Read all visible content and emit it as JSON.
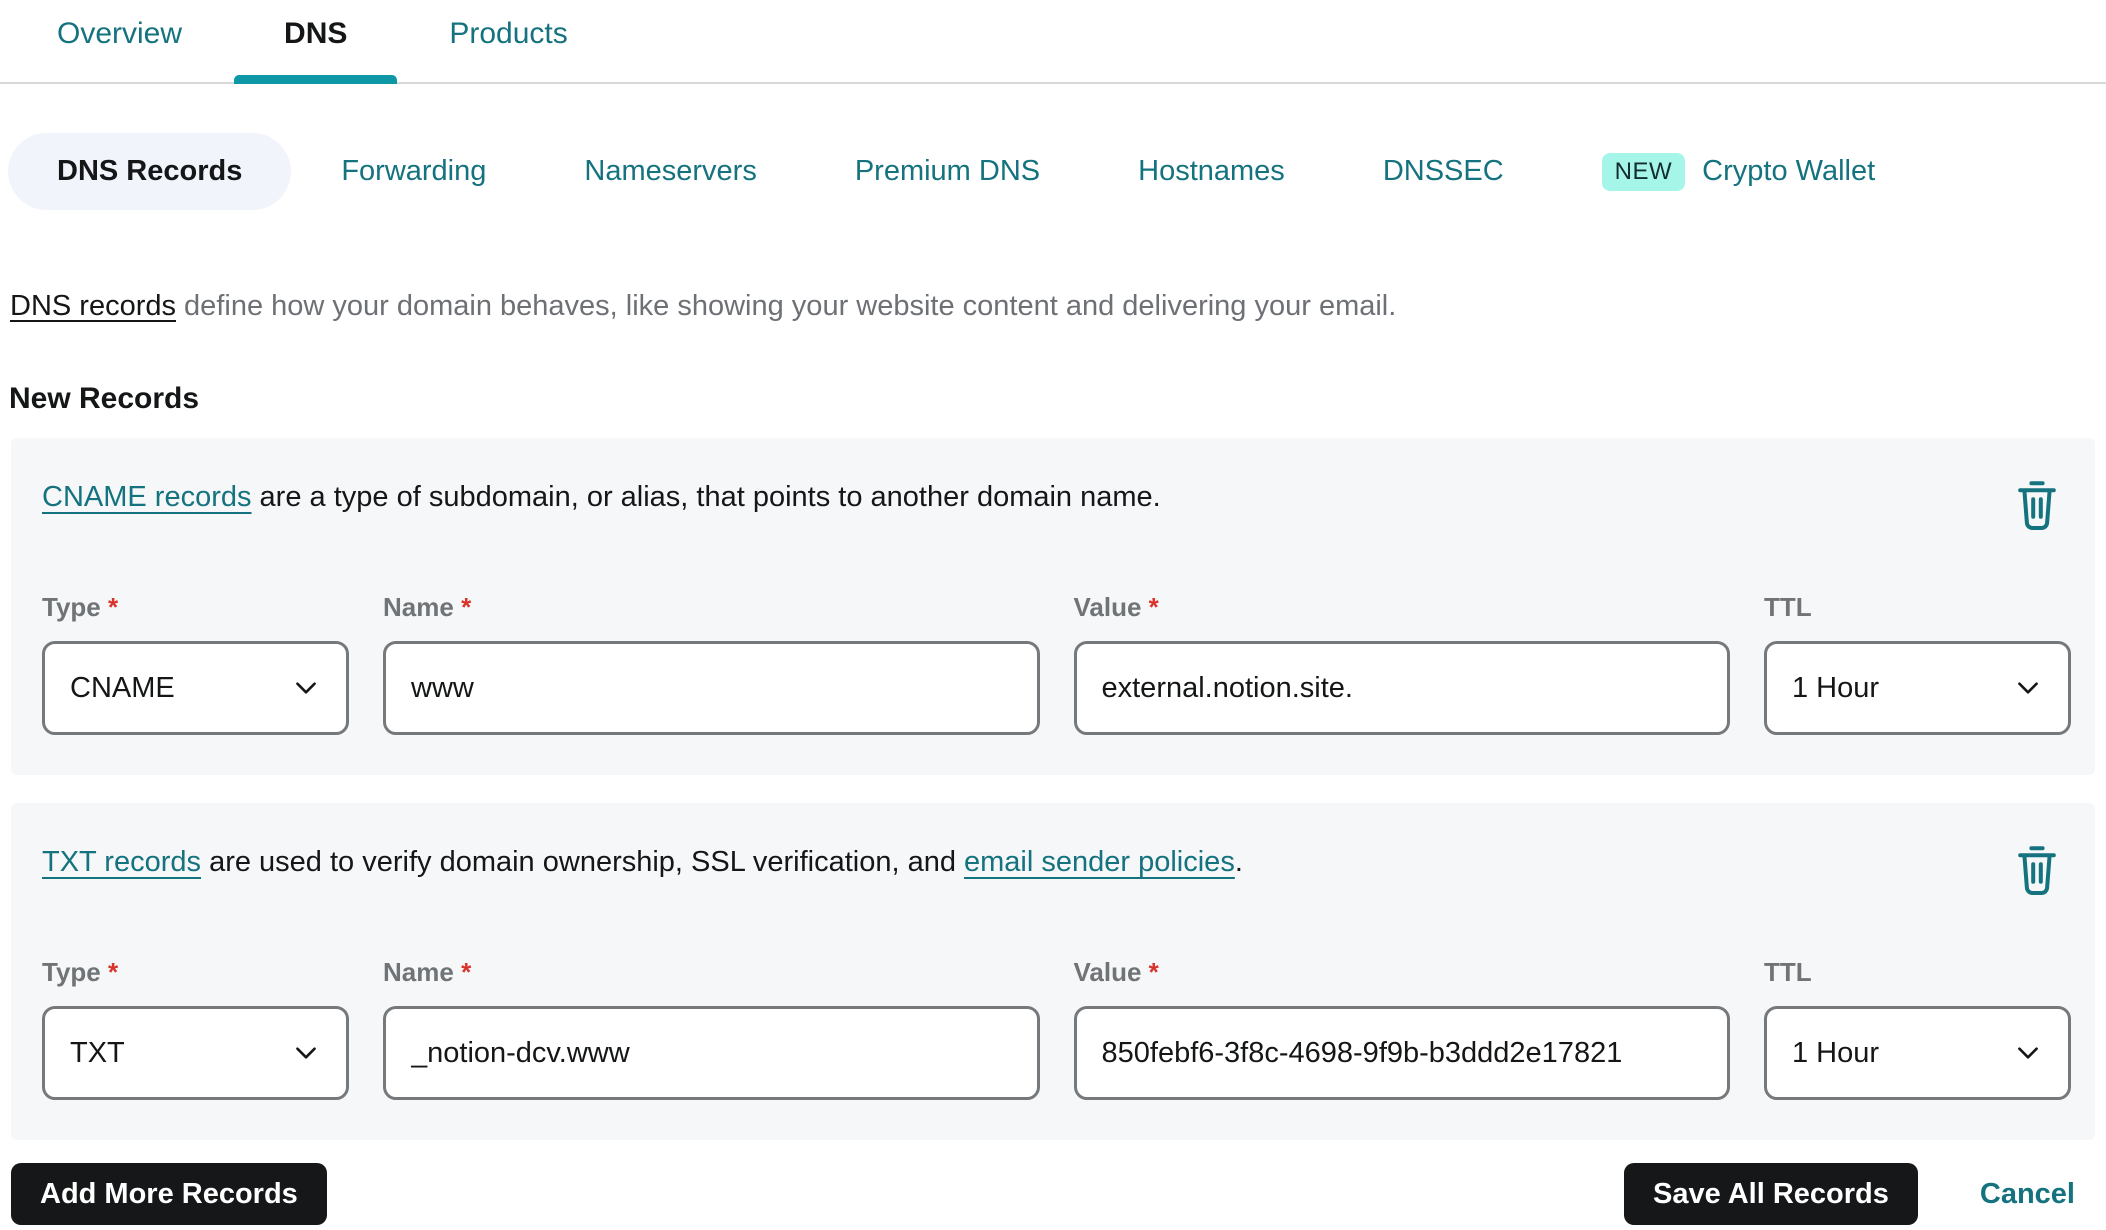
{
  "tabs": {
    "items": [
      {
        "label": "Overview"
      },
      {
        "label": "DNS"
      },
      {
        "label": "Products"
      }
    ]
  },
  "subtabs": {
    "items": [
      {
        "label": "DNS Records"
      },
      {
        "label": "Forwarding"
      },
      {
        "label": "Nameservers"
      },
      {
        "label": "Premium DNS"
      },
      {
        "label": "Hostnames"
      },
      {
        "label": "DNSSEC"
      },
      {
        "label": "Crypto Wallet",
        "badge": "NEW"
      }
    ]
  },
  "intro": {
    "link": "DNS records",
    "text": " define how your domain behaves, like showing your website content and delivering your email."
  },
  "section": {
    "heading": "New Records"
  },
  "required_marker": "*",
  "records": [
    {
      "description": {
        "link1": "CNAME records",
        "text1": " are a type of subdomain, or alias, that points to another domain name.",
        "link2": "",
        "text2": ""
      },
      "type": {
        "label": "Type",
        "value": "CNAME"
      },
      "name": {
        "label": "Name",
        "value": "www"
      },
      "value": {
        "label": "Value",
        "value": "external.notion.site."
      },
      "ttl": {
        "label": "TTL",
        "value": "1 Hour"
      }
    },
    {
      "description": {
        "link1": "TXT records",
        "text1": " are used to verify domain ownership, SSL verification, and ",
        "link2": "email sender policies",
        "text2": "."
      },
      "type": {
        "label": "Type",
        "value": "TXT"
      },
      "name": {
        "label": "Name",
        "value": "_notion-dcv.www"
      },
      "value": {
        "label": "Value",
        "value": "850febf6-3f8c-4698-9f9b-b3ddd2e17821"
      },
      "ttl": {
        "label": "TTL",
        "value": "1 Hour"
      }
    }
  ],
  "footer": {
    "add": "Add More Records",
    "save": "Save All Records",
    "cancel": "Cancel"
  },
  "colors": {
    "teal_link": "#15727f",
    "active_tab_underline": "#0e98a6",
    "new_badge_bg": "#a5f6e9",
    "card_bg": "#f5f7f8",
    "button_bg": "#151718",
    "required_red": "#da332c"
  }
}
